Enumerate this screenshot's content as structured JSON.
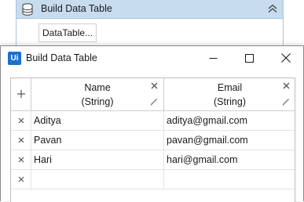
{
  "activity": {
    "title": "Build Data Table",
    "button_label": "DataTable..."
  },
  "dialog": {
    "app_icon_label": "Ui",
    "title": "Build Data Table"
  },
  "grid": {
    "columns": [
      {
        "name": "Name",
        "type": "(String)"
      },
      {
        "name": "Email",
        "type": "(String)"
      }
    ],
    "rows": [
      {
        "name": "Aditya",
        "email": "aditya@gmail.com"
      },
      {
        "name": "Pavan",
        "email": "pavan@gmail.com"
      },
      {
        "name": "Hari",
        "email": "hari@gmail.com"
      },
      {
        "name": "",
        "email": ""
      }
    ]
  },
  "colors": {
    "activity_header": "#c8dcef",
    "app_icon": "#1f6fcf",
    "grid_border": "#bdbdbd"
  },
  "icons": [
    "database-icon",
    "collapse-chevron-icon",
    "minimize-icon",
    "maximize-icon",
    "close-icon",
    "add-row-icon",
    "remove-column-icon",
    "edit-column-icon",
    "remove-row-icon"
  ]
}
